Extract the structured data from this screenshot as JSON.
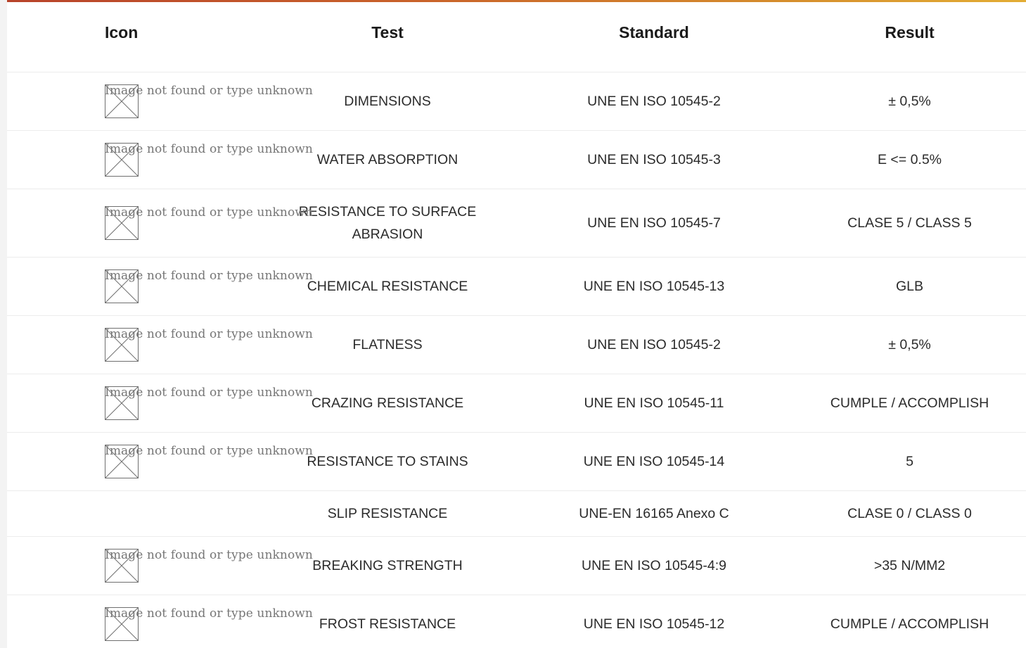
{
  "table": {
    "headers": {
      "icon": "Icon",
      "test": "Test",
      "standard": "Standard",
      "result": "Result"
    },
    "broken_image_alt": "Image not found or type unknown",
    "rows": [
      {
        "test": "DIMENSIONS",
        "standard": "UNE EN ISO 10545-2",
        "result": "± 0,5%",
        "has_icon": true
      },
      {
        "test": "WATER ABSORPTION",
        "standard": "UNE EN ISO 10545-3",
        "result": "E <= 0.5%",
        "has_icon": true
      },
      {
        "test": "RESISTANCE TO SURFACE ABRASION",
        "standard": "UNE EN ISO 10545-7",
        "result": "CLASE 5 / CLASS 5",
        "has_icon": true
      },
      {
        "test": "CHEMICAL RESISTANCE",
        "standard": "UNE EN ISO 10545-13",
        "result": "GLB",
        "has_icon": true
      },
      {
        "test": "FLATNESS",
        "standard": "UNE EN ISO 10545-2",
        "result": "± 0,5%",
        "has_icon": true
      },
      {
        "test": "CRAZING RESISTANCE",
        "standard": "UNE EN ISO 10545-11",
        "result": "CUMPLE / ACCOMPLISH",
        "has_icon": true
      },
      {
        "test": "RESISTANCE TO STAINS",
        "standard": "UNE EN ISO 10545-14",
        "result": "5",
        "has_icon": true
      },
      {
        "test": "SLIP RESISTANCE",
        "standard": "UNE-EN 16165 Anexo C",
        "result": "CLASE 0 / CLASS 0",
        "has_icon": false
      },
      {
        "test": "BREAKING STRENGTH",
        "standard": "UNE EN ISO 10545-4:9",
        "result": ">35 N/MM2",
        "has_icon": true
      },
      {
        "test": "FROST RESISTANCE",
        "standard": "UNE EN ISO 10545-12",
        "result": "CUMPLE / ACCOMPLISH",
        "has_icon": true
      }
    ]
  },
  "colors": {
    "accent_start": "#b8432a",
    "accent_end": "#e3ad34",
    "row_divider": "#ececec",
    "text": "#2b2b2b"
  }
}
